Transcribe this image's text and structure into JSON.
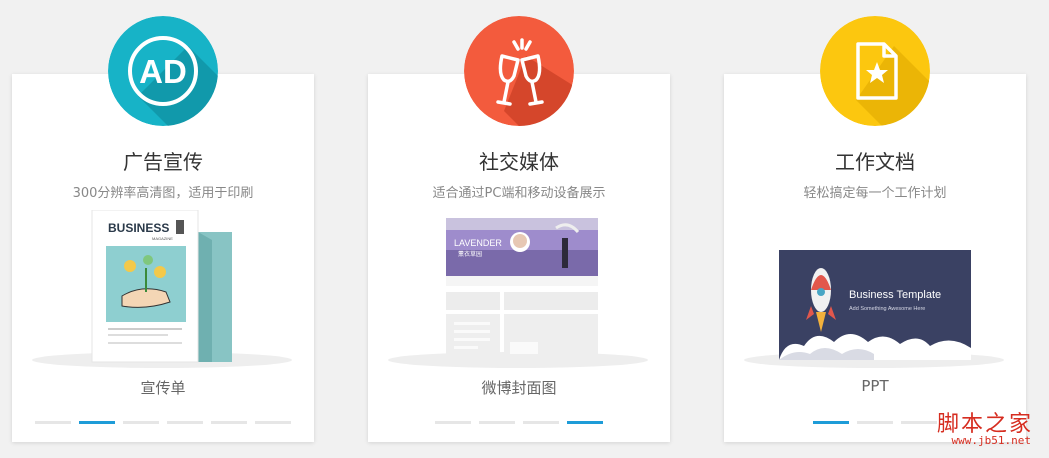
{
  "cards": [
    {
      "icon": "ad-icon",
      "icon_text": "AD",
      "title": "广告宣传",
      "subtitle": "300分辨率高清图，适用于印刷",
      "preview_text": "BUSINESS",
      "preview_subtext": "MAGAZINE",
      "caption": "宣传单",
      "active_dot": 2,
      "dots": 6
    },
    {
      "icon": "champagne-glasses-icon",
      "title": "社交媒体",
      "subtitle": "适合通过PC端和移动设备展示",
      "preview_text": "LAVENDER",
      "preview_subtext": "薰衣草园",
      "caption": "微博封面图",
      "active_dot": 4,
      "dots": 4
    },
    {
      "icon": "star-document-icon",
      "title": "工作文档",
      "subtitle": "轻松搞定每一个工作计划",
      "preview_text": "Business Template",
      "preview_subtext": "Add Something Awesome Here",
      "caption": "PPT",
      "active_dot": 1,
      "dots": 3
    }
  ],
  "colors": {
    "card1_icon": "#17b3c7",
    "card2_icon": "#f35b3d",
    "card3_icon": "#fcc70f",
    "active_dot": "#1e9cd8"
  },
  "watermark": {
    "main": "脚本之家",
    "sub": "www.jb51.net"
  }
}
